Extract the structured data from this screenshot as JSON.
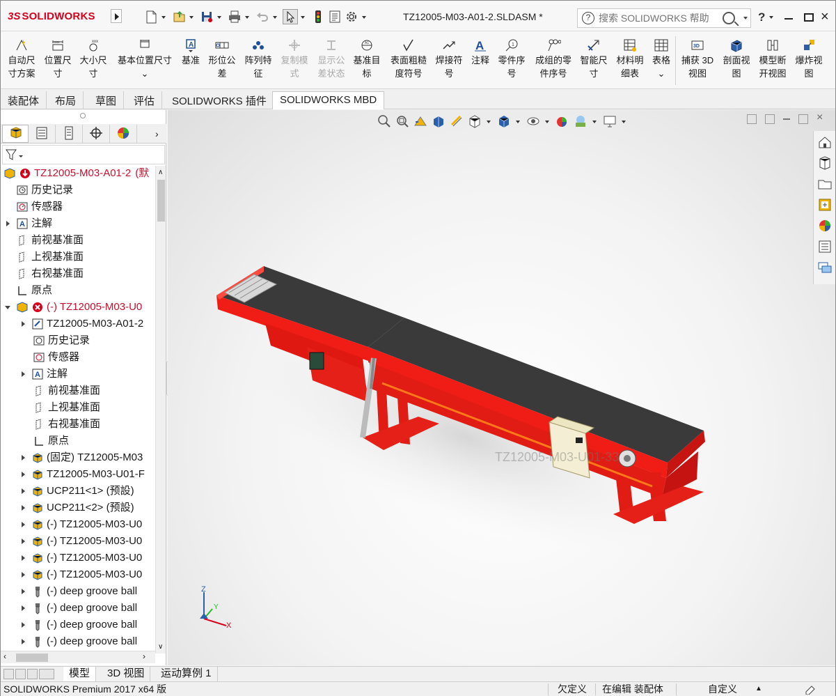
{
  "app": {
    "brand_ds": "3S",
    "brand_name": "SOLIDWORKS",
    "document_title": "TZ12005-M03-A01-2.SLDASM *",
    "search_placeholder": "搜索 SOLIDWORKS 帮助",
    "help_label": "?",
    "close_label": "×"
  },
  "ribbon": {
    "buttons": [
      {
        "line1": "自动尺",
        "line2": "寸方案"
      },
      {
        "line1": "位置尺",
        "line2": "寸"
      },
      {
        "line1": "大小尺",
        "line2": "寸"
      },
      {
        "line1": "基本位置尺寸",
        "line2": ""
      },
      {
        "line1": "基准",
        "line2": ""
      },
      {
        "line1": "形位公",
        "line2": "差"
      },
      {
        "line1": "阵列特",
        "line2": "征"
      },
      {
        "line1": "复制模",
        "line2": "式"
      },
      {
        "line1": "显示公",
        "line2": "差状态"
      },
      {
        "line1": "基准目",
        "line2": "标"
      },
      {
        "line1": "表面粗糙",
        "line2": "度符号"
      },
      {
        "line1": "焊接符",
        "line2": "号"
      },
      {
        "line1": "注释",
        "line2": ""
      },
      {
        "line1": "零件序",
        "line2": "号"
      },
      {
        "line1": "成组的零",
        "line2": "件序号"
      },
      {
        "line1": "智能尺",
        "line2": "寸"
      },
      {
        "line1": "材料明",
        "line2": "细表"
      },
      {
        "line1": "表格",
        "line2": ""
      },
      {
        "line1": "捕获 3D",
        "line2": "视图"
      },
      {
        "line1": "剖面视",
        "line2": "图"
      },
      {
        "line1": "模型断",
        "line2": "开视图"
      },
      {
        "line1": "爆炸视",
        "line2": "图"
      }
    ]
  },
  "tabs": [
    "装配体",
    "布局",
    "草图",
    "评估",
    "SOLIDWORKS 插件",
    "SOLIDWORKS MBD"
  ],
  "tree": {
    "root": "TZ12005-M03-A01-2",
    "root_suffix": "(默",
    "items": [
      {
        "label": "历史记录"
      },
      {
        "label": "传感器"
      },
      {
        "label": "注解"
      },
      {
        "label": "前视基准面"
      },
      {
        "label": "上视基准面"
      },
      {
        "label": "右视基准面"
      },
      {
        "label": "原点"
      },
      {
        "label": "(-) TZ12005-M03-U0"
      },
      {
        "label": "TZ12005-M03-A01-2"
      },
      {
        "label": "历史记录"
      },
      {
        "label": "传感器"
      },
      {
        "label": "注解"
      },
      {
        "label": "前视基准面"
      },
      {
        "label": "上视基准面"
      },
      {
        "label": "右视基准面"
      },
      {
        "label": "原点"
      },
      {
        "label": "(固定) TZ12005-M03"
      },
      {
        "label": "TZ12005-M03-U01-F"
      },
      {
        "label": "UCP211<1> (预設)"
      },
      {
        "label": "UCP211<2> (预設)"
      },
      {
        "label": "(-) TZ12005-M03-U0"
      },
      {
        "label": "(-) TZ12005-M03-U0"
      },
      {
        "label": "(-) TZ12005-M03-U0"
      },
      {
        "label": "(-) TZ12005-M03-U0"
      },
      {
        "label": "(-) deep groove ball"
      },
      {
        "label": "(-) deep groove ball"
      },
      {
        "label": "(-) deep groove ball"
      },
      {
        "label": "(-) deep groove ball"
      }
    ]
  },
  "viewport": {
    "ghost_label": "TZ12005-M03-U01-33",
    "triad": {
      "z": "Z",
      "y": "Y",
      "x": "X"
    }
  },
  "bottom_tabs": [
    "模型",
    "3D 视图",
    "运动算例 1"
  ],
  "status": {
    "product": "SOLIDWORKS Premium 2017 x64 版",
    "underdefined": "欠定义",
    "editing": "在编辑 装配体",
    "custom": "自定义"
  },
  "colors": {
    "brand": "#d7001b",
    "conveyor_body": "#f01c16",
    "belt": "#3a3a3a",
    "error_red": "#c8102e"
  }
}
